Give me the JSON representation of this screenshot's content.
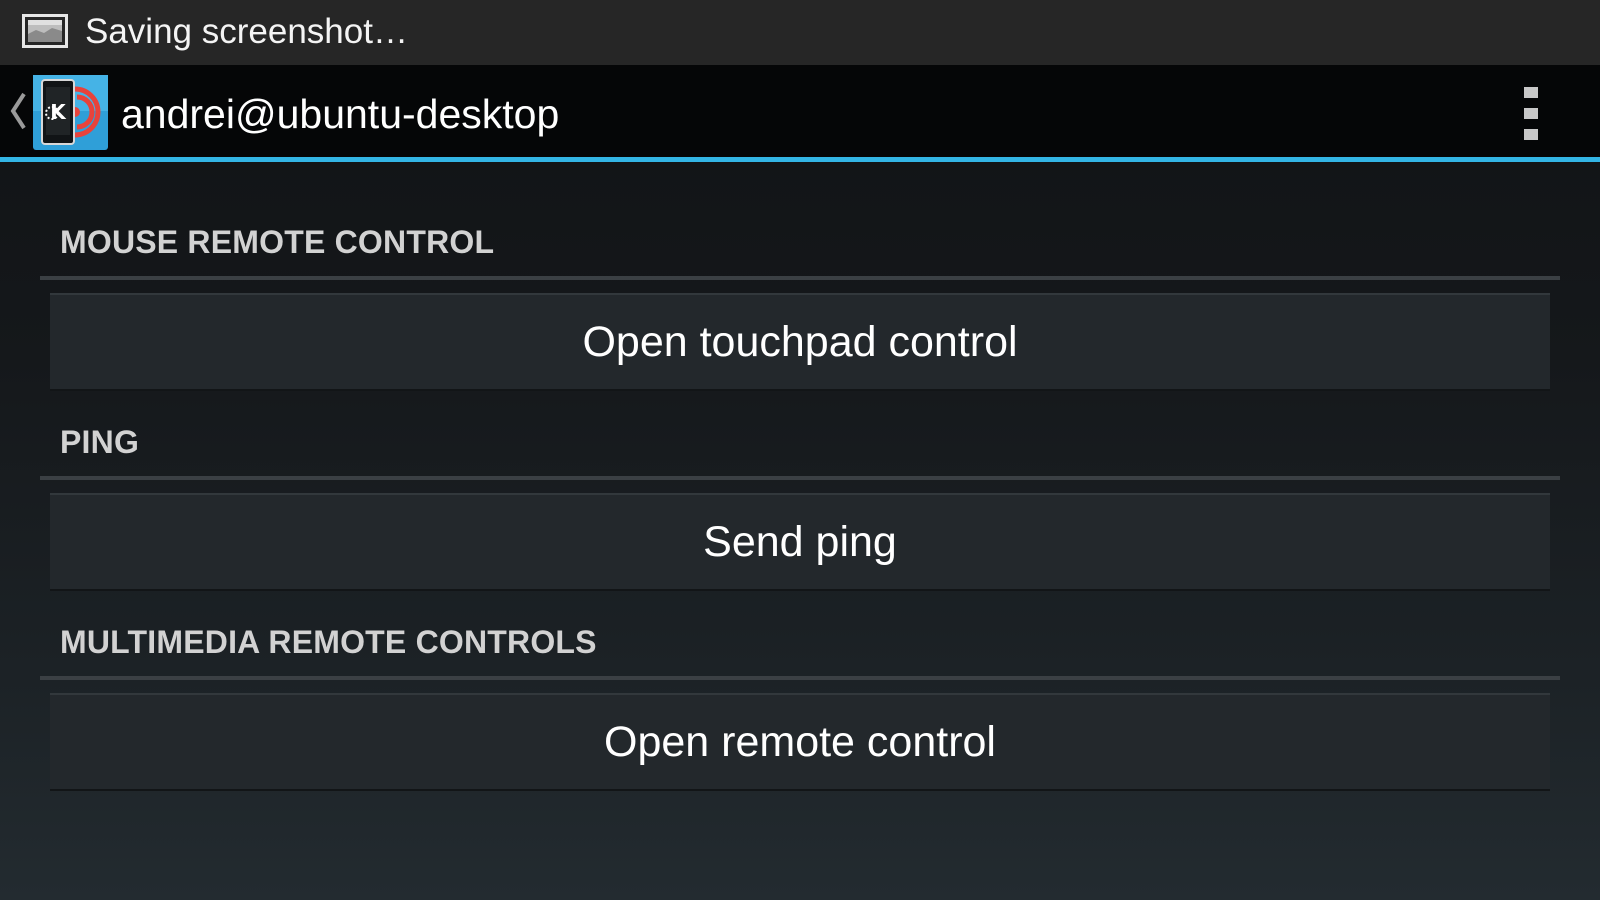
{
  "status_bar": {
    "notification_text": "Saving screenshot…",
    "notification_icon": "screenshot-icon"
  },
  "action_bar": {
    "title": "andrei@ubuntu-desktop",
    "app_icon": "kde-connect-icon",
    "up_icon": "chevron-left-icon",
    "menu_icon": "overflow-menu-icon",
    "accent_color": "#33b5e5"
  },
  "sections": [
    {
      "header": "MOUSE REMOTE CONTROL",
      "button_label": "Open touchpad control"
    },
    {
      "header": "PING",
      "button_label": "Send ping"
    },
    {
      "header": "MULTIMEDIA REMOTE CONTROLS",
      "button_label": "Open remote control"
    }
  ]
}
